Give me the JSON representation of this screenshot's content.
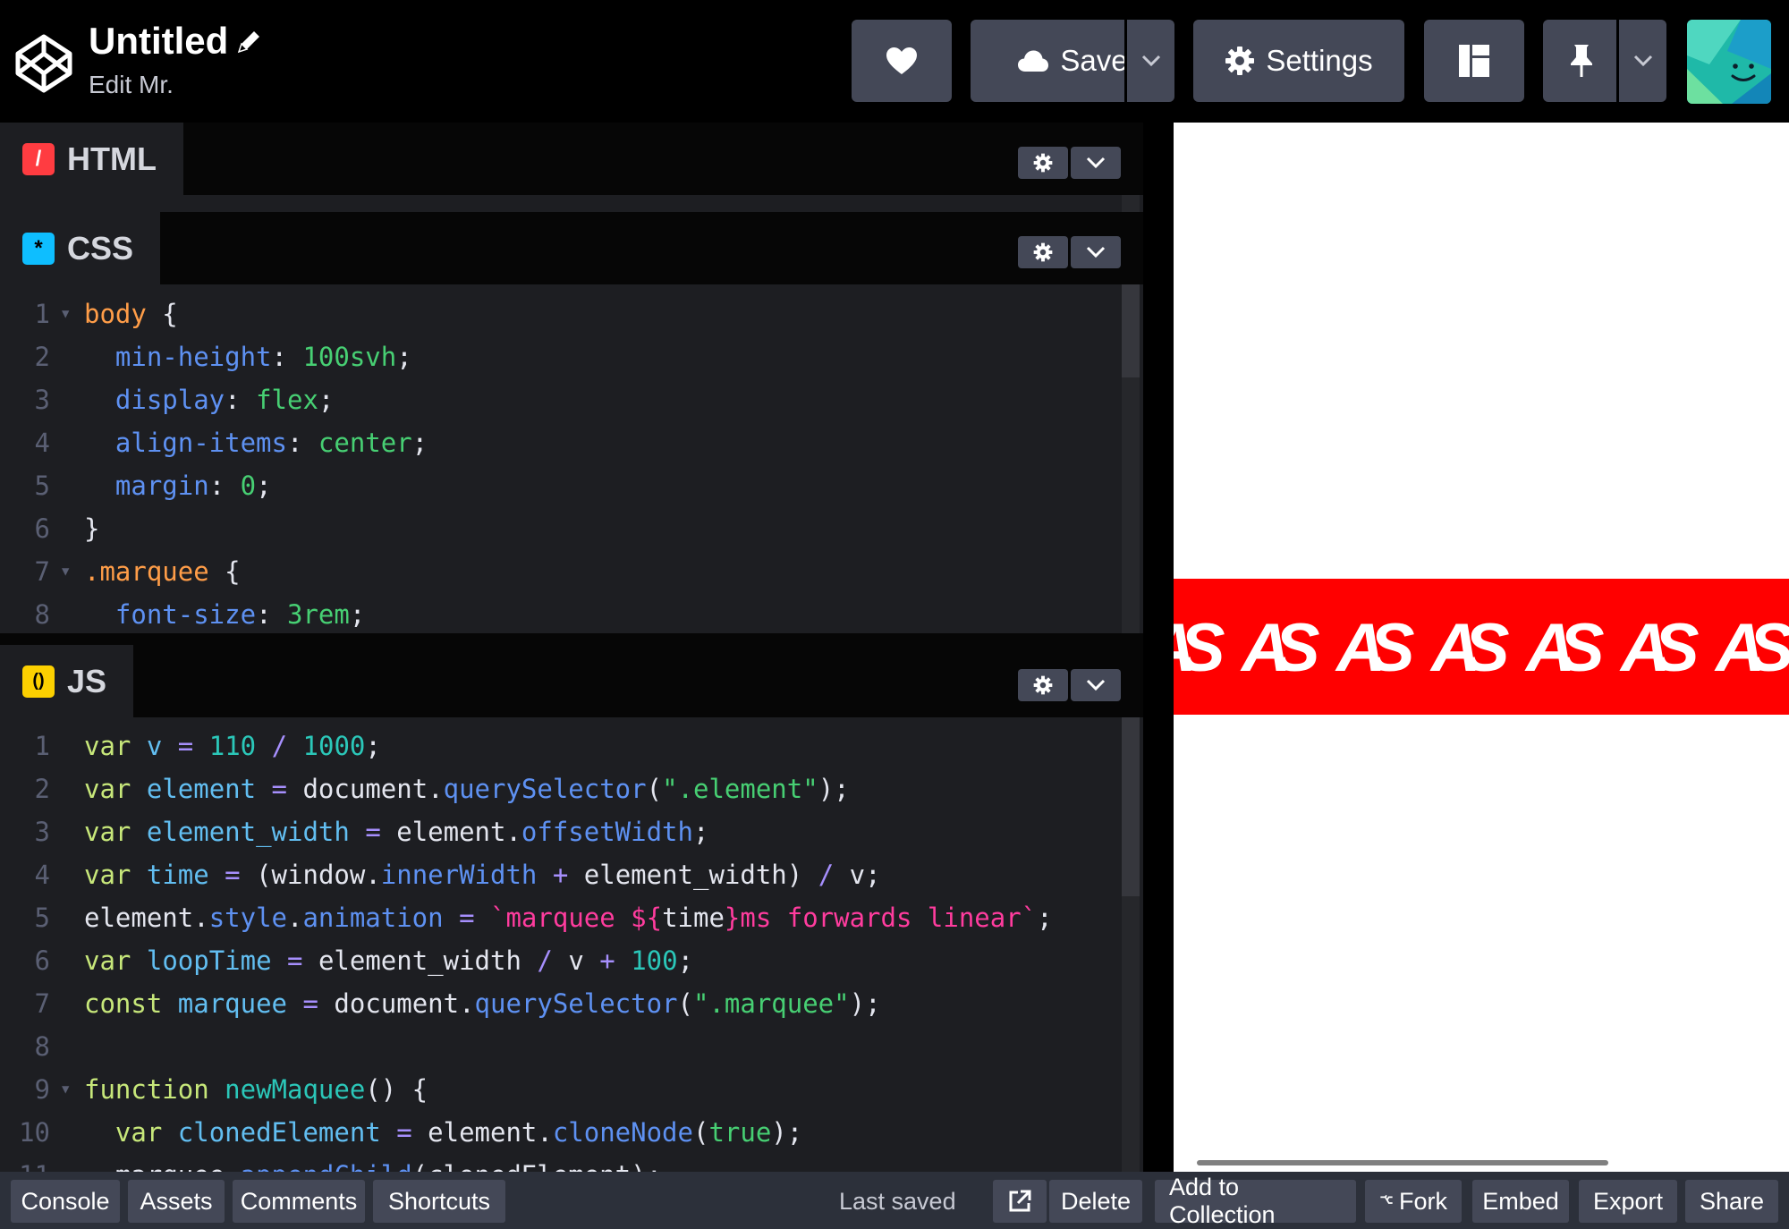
{
  "header": {
    "title": "Untitled",
    "owner": "Edit Mr.",
    "save_label": "Save",
    "settings_label": "Settings"
  },
  "html_pane": {
    "label": "HTML",
    "badge": "/"
  },
  "css_pane": {
    "label": "CSS",
    "badge": "*",
    "lines": [
      {
        "n": "1",
        "fold": true,
        "tokens": [
          [
            "c-sel",
            "body"
          ],
          [
            "c-plain",
            " {"
          ]
        ]
      },
      {
        "n": "2",
        "tokens": [
          [
            "c-prop",
            "  min-height"
          ],
          [
            "c-plain",
            ": "
          ],
          [
            "c-val",
            "100svh"
          ],
          [
            "c-plain",
            ";"
          ]
        ]
      },
      {
        "n": "3",
        "tokens": [
          [
            "c-prop",
            "  display"
          ],
          [
            "c-plain",
            ": "
          ],
          [
            "c-val",
            "flex"
          ],
          [
            "c-plain",
            ";"
          ]
        ]
      },
      {
        "n": "4",
        "tokens": [
          [
            "c-prop",
            "  align-items"
          ],
          [
            "c-plain",
            ": "
          ],
          [
            "c-val",
            "center"
          ],
          [
            "c-plain",
            ";"
          ]
        ]
      },
      {
        "n": "5",
        "tokens": [
          [
            "c-prop",
            "  margin"
          ],
          [
            "c-plain",
            ": "
          ],
          [
            "c-val",
            "0"
          ],
          [
            "c-plain",
            ";"
          ]
        ]
      },
      {
        "n": "6",
        "tokens": [
          [
            "c-plain",
            "}"
          ]
        ]
      },
      {
        "n": "7",
        "fold": true,
        "tokens": [
          [
            "c-sel",
            ".marquee"
          ],
          [
            "c-plain",
            " {"
          ]
        ]
      },
      {
        "n": "8",
        "tokens": [
          [
            "c-prop",
            "  font-size"
          ],
          [
            "c-plain",
            ": "
          ],
          [
            "c-val",
            "3rem"
          ],
          [
            "c-plain",
            ";"
          ]
        ]
      }
    ]
  },
  "js_pane": {
    "label": "JS",
    "badge": "()",
    "lines": [
      {
        "n": "1",
        "tokens": [
          [
            "c-kw",
            "var"
          ],
          [
            "c-plain",
            " "
          ],
          [
            "c-var",
            "v"
          ],
          [
            "c-plain",
            " "
          ],
          [
            "c-op",
            "="
          ],
          [
            "c-plain",
            " "
          ],
          [
            "c-num",
            "110"
          ],
          [
            "c-plain",
            " "
          ],
          [
            "c-op",
            "/"
          ],
          [
            "c-plain",
            " "
          ],
          [
            "c-num",
            "1000"
          ],
          [
            "c-plain",
            ";"
          ]
        ]
      },
      {
        "n": "2",
        "tokens": [
          [
            "c-kw",
            "var"
          ],
          [
            "c-plain",
            " "
          ],
          [
            "c-var",
            "element"
          ],
          [
            "c-plain",
            " "
          ],
          [
            "c-op",
            "="
          ],
          [
            "c-plain",
            " document."
          ],
          [
            "c-prop",
            "querySelector"
          ],
          [
            "c-plain",
            "("
          ],
          [
            "c-val",
            "\".element\""
          ],
          [
            "c-plain",
            ");"
          ]
        ]
      },
      {
        "n": "3",
        "tokens": [
          [
            "c-kw",
            "var"
          ],
          [
            "c-plain",
            " "
          ],
          [
            "c-var",
            "element_width"
          ],
          [
            "c-plain",
            " "
          ],
          [
            "c-op",
            "="
          ],
          [
            "c-plain",
            " element."
          ],
          [
            "c-prop",
            "offsetWidth"
          ],
          [
            "c-plain",
            ";"
          ]
        ]
      },
      {
        "n": "4",
        "tokens": [
          [
            "c-kw",
            "var"
          ],
          [
            "c-plain",
            " "
          ],
          [
            "c-var",
            "time"
          ],
          [
            "c-plain",
            " "
          ],
          [
            "c-op",
            "="
          ],
          [
            "c-plain",
            " (window."
          ],
          [
            "c-prop",
            "innerWidth"
          ],
          [
            "c-plain",
            " "
          ],
          [
            "c-op",
            "+"
          ],
          [
            "c-plain",
            " element_width) "
          ],
          [
            "c-op",
            "/"
          ],
          [
            "c-plain",
            " v;"
          ]
        ]
      },
      {
        "n": "5",
        "tokens": [
          [
            "c-plain",
            "element."
          ],
          [
            "c-prop",
            "style"
          ],
          [
            "c-plain",
            "."
          ],
          [
            "c-prop",
            "animation"
          ],
          [
            "c-plain",
            " "
          ],
          [
            "c-op",
            "="
          ],
          [
            "c-plain",
            " "
          ],
          [
            "c-str",
            "`marquee ${"
          ],
          [
            "c-plain",
            "time"
          ],
          [
            "c-str",
            "}ms forwards linear`"
          ],
          [
            "c-plain",
            ";"
          ]
        ]
      },
      {
        "n": "6",
        "tokens": [
          [
            "c-kw",
            "var"
          ],
          [
            "c-plain",
            " "
          ],
          [
            "c-var",
            "loopTime"
          ],
          [
            "c-plain",
            " "
          ],
          [
            "c-op",
            "="
          ],
          [
            "c-plain",
            " element_width "
          ],
          [
            "c-op",
            "/"
          ],
          [
            "c-plain",
            " v "
          ],
          [
            "c-op",
            "+"
          ],
          [
            "c-plain",
            " "
          ],
          [
            "c-num",
            "100"
          ],
          [
            "c-plain",
            ";"
          ]
        ]
      },
      {
        "n": "7",
        "tokens": [
          [
            "c-kw",
            "const"
          ],
          [
            "c-plain",
            " "
          ],
          [
            "c-var",
            "marquee"
          ],
          [
            "c-plain",
            " "
          ],
          [
            "c-op",
            "="
          ],
          [
            "c-plain",
            " document."
          ],
          [
            "c-prop",
            "querySelector"
          ],
          [
            "c-plain",
            "("
          ],
          [
            "c-val",
            "\".marquee\""
          ],
          [
            "c-plain",
            ");"
          ]
        ]
      },
      {
        "n": "8",
        "tokens": []
      },
      {
        "n": "9",
        "fold": true,
        "tokens": [
          [
            "c-kw",
            "function"
          ],
          [
            "c-plain",
            " "
          ],
          [
            "c-fn",
            "newMaquee"
          ],
          [
            "c-plain",
            "() {"
          ]
        ]
      },
      {
        "n": "10",
        "tokens": [
          [
            "c-kw",
            "  var"
          ],
          [
            "c-plain",
            " "
          ],
          [
            "c-var",
            "clonedElement"
          ],
          [
            "c-plain",
            " "
          ],
          [
            "c-op",
            "="
          ],
          [
            "c-plain",
            " element."
          ],
          [
            "c-prop",
            "cloneNode"
          ],
          [
            "c-plain",
            "("
          ],
          [
            "c-val",
            "true"
          ],
          [
            "c-plain",
            ");"
          ]
        ]
      },
      {
        "n": "11",
        "tokens": [
          [
            "c-plain",
            "  marquee."
          ],
          [
            "c-prop",
            "appendChild"
          ],
          [
            "c-plain",
            "(clonedElement);"
          ]
        ]
      }
    ]
  },
  "preview": {
    "marquee_text": "AS"
  },
  "footer": {
    "console": "Console",
    "assets": "Assets",
    "comments": "Comments",
    "shortcuts": "Shortcuts",
    "last_saved": "Last saved",
    "delete": "Delete",
    "add_to_collection": "Add to Collection",
    "fork": "Fork",
    "embed": "Embed",
    "export": "Export",
    "share": "Share"
  },
  "icons": {
    "logo": "codepen-logo-icon",
    "pencil": "pencil-icon",
    "heart": "heart-icon",
    "cloud": "cloud-icon",
    "gear": "gear-icon",
    "layout": "layout-icon",
    "pin": "pin-icon",
    "chevron": "chevron-down-icon",
    "external": "external-link-icon",
    "fork": "fork-icon"
  },
  "colors": {
    "html_badge": "#ff3c41",
    "css_badge": "#0ebeff",
    "js_badge": "#fcd000",
    "marquee_bg": "#ff0000"
  }
}
